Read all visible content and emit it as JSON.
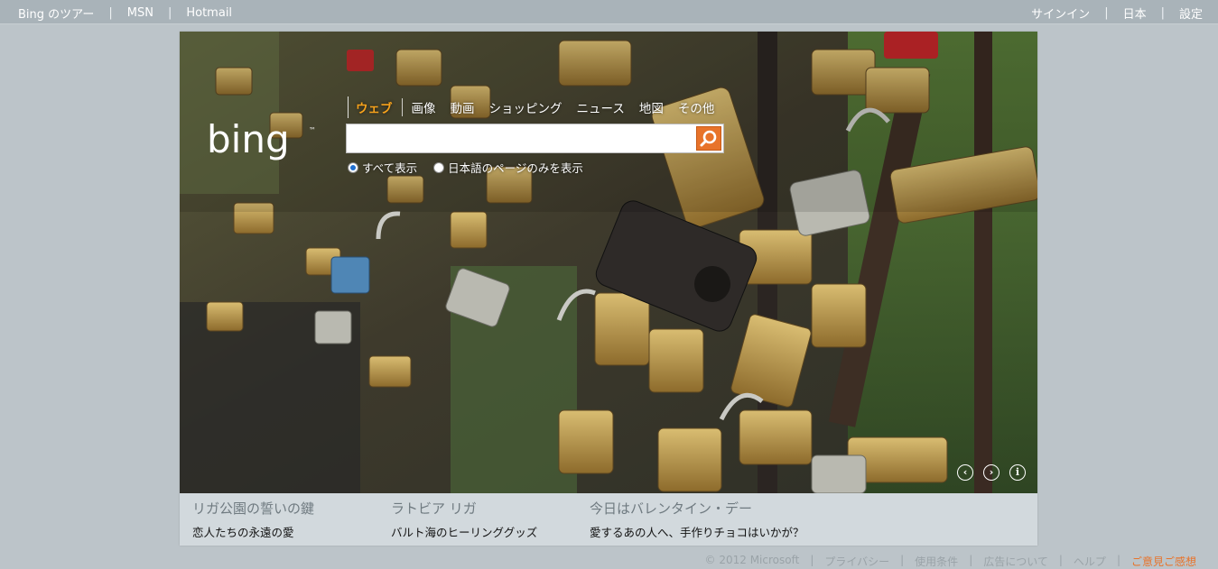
{
  "topnav": {
    "left": [
      "Bing のツアー",
      "MSN",
      "Hotmail"
    ],
    "right": [
      "サインイン",
      "日本",
      "設定"
    ],
    "separator": "|"
  },
  "search": {
    "tabs": [
      "ウェブ",
      "画像",
      "動画",
      "ショッピング",
      "ニュース",
      "地図",
      "その他"
    ],
    "active_tab": "ウェブ",
    "input_value": "",
    "option_all": "すべて表示",
    "option_japanese": "日本語のページのみを表示",
    "selected_option": "すべて表示"
  },
  "logo": {
    "text": "bing",
    "tm": "™"
  },
  "hero_controls": {
    "prev": "‹",
    "next": "›",
    "info": "i"
  },
  "hotspots": [
    {
      "title": "リガ公園の誓いの鍵",
      "subtitle": "恋人たちの永遠の愛"
    },
    {
      "title": "ラトビア リガ",
      "subtitle": "バルト海のヒーリンググッズ"
    },
    {
      "title": "今日はバレンタイン・デー",
      "subtitle": "愛するあの人へ、手作りチョコはいかが？"
    }
  ],
  "footer": {
    "items": [
      "© 2012 Microsoft",
      "プライバシー",
      "使用条件",
      "広告について",
      "ヘルプ"
    ],
    "feedback": "ご意見ご感想",
    "separator": "|"
  },
  "colors": {
    "accent": "#e8732a",
    "active_tab": "#f6a21c",
    "background": "#bcc4c9",
    "topbar": "#a9b3b9"
  }
}
